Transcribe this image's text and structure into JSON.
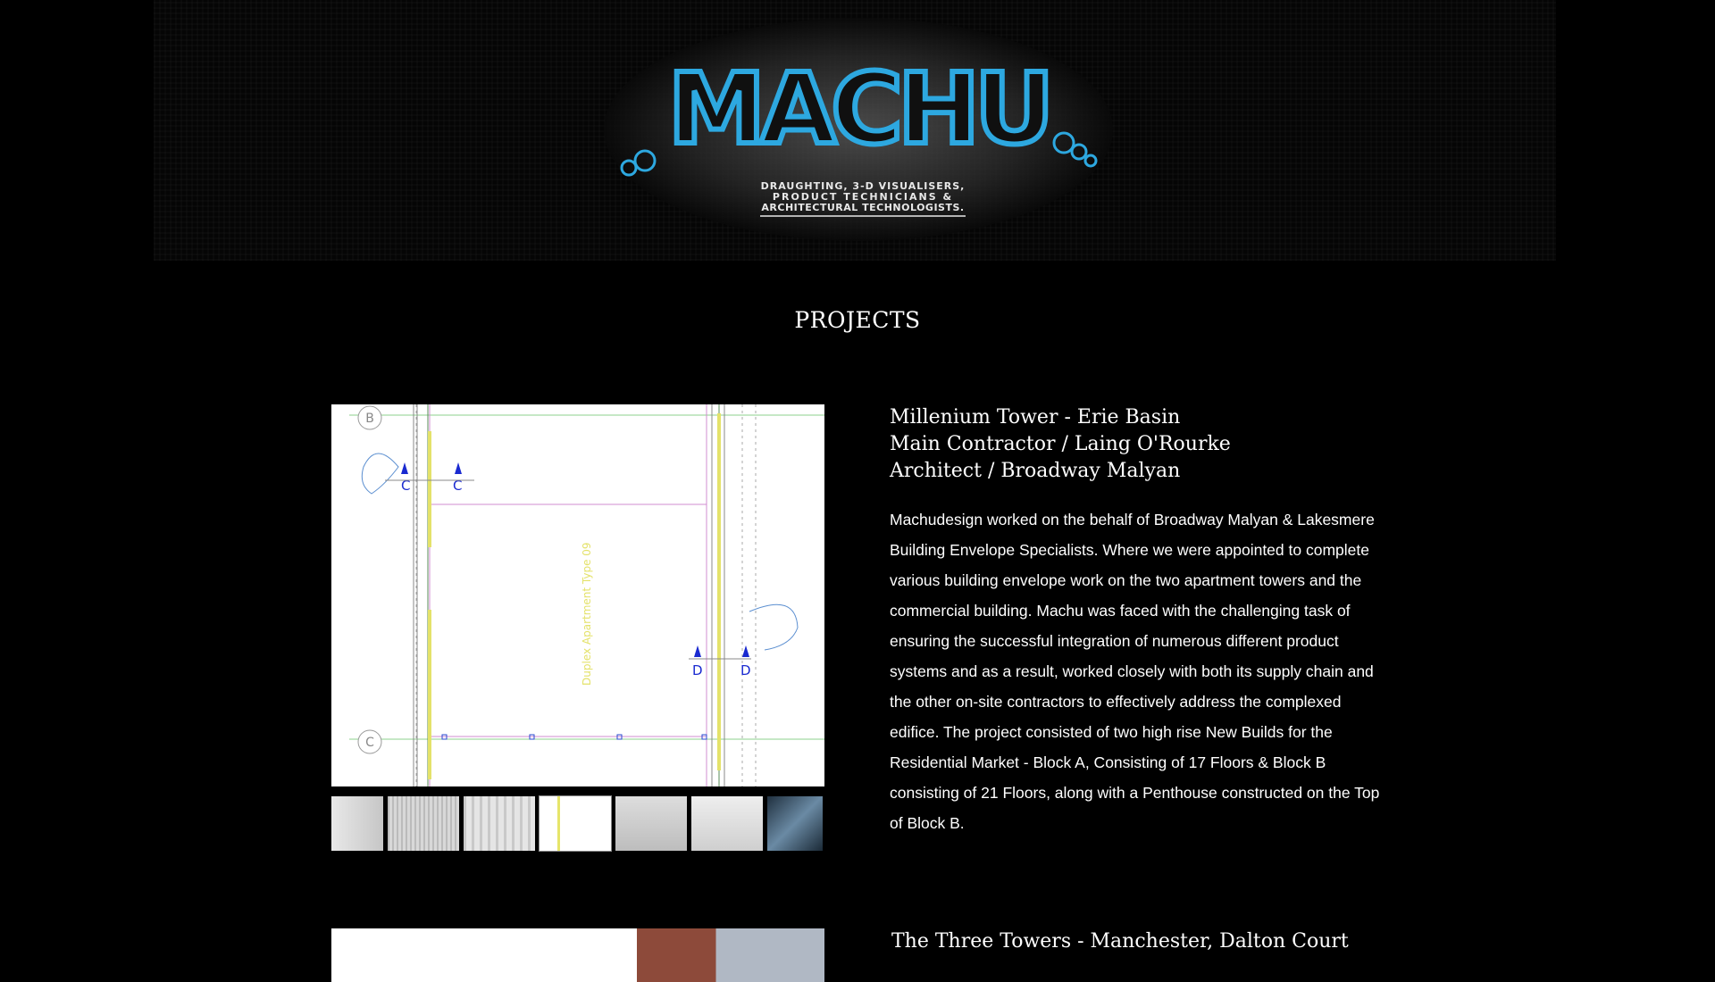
{
  "header": {
    "logo_text": "MACHU",
    "logo_tagline_lines": [
      "DRAUGHTING, 3-D VISUALISERS,",
      "PRODUCT TECHNICIANS &",
      "ARCHITECTURAL TECHNOLOGISTS."
    ]
  },
  "section": {
    "title": "PROJECTS"
  },
  "projects": [
    {
      "title_lines": [
        "Millenium Tower - Erie Basin",
        "Main Contractor / Laing O'Rourke",
        "Architect / Broadway Malyan"
      ],
      "description": "Machudesign worked on the behalf of Broadway Malyan & Lakesmere Building Envelope Specialists. Where we were appointed to complete various building envelope work on the two apartment towers and the commercial building. Machu was faced with the challenging task of ensuring the successful integration of numerous different product systems and as a result, worked closely with both its supply chain and the other on-site contractors to effectively address the complexed edifice. The project consisted of two high rise New Builds for the Residential Market - Block A, Consisting of 17 Floors & Block B consisting of 21 Floors, along with a Penthouse constructed on the Top of Block B.",
      "drawing_labels": {
        "grid_b": "B",
        "grid_c": "C",
        "section_c": "C",
        "section_d": "D",
        "vertical_note": "Duplex Apartment Type 09"
      },
      "thumbnail_count": 7
    },
    {
      "title_lines": [
        "The Three Towers - Manchester, Dalton Court"
      ]
    }
  ]
}
